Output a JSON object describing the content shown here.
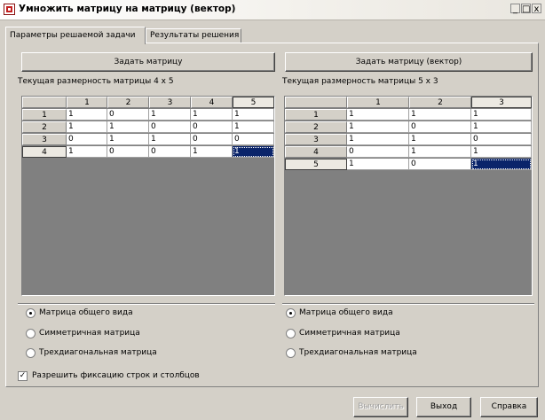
{
  "window": {
    "title": "Умножить матрицу на матрицу (вектор)",
    "minimize_glyph": "_",
    "maximize_glyph": "□",
    "close_glyph": "x"
  },
  "tabs": [
    {
      "label": "Параметры решаемой задачи",
      "active": true
    },
    {
      "label": "Результаты решения",
      "active": false
    }
  ],
  "left": {
    "button_label": "Задать матрицу",
    "dims_label": "Текущая размерность матрицы 4 x 5",
    "col_headers": [
      "1",
      "2",
      "3",
      "4",
      "5"
    ],
    "row_headers": [
      "1",
      "2",
      "3",
      "4"
    ],
    "rows": [
      [
        "1",
        "0",
        "1",
        "1",
        "1"
      ],
      [
        "1",
        "1",
        "0",
        "0",
        "1"
      ],
      [
        "0",
        "1",
        "1",
        "0",
        "0"
      ],
      [
        "1",
        "0",
        "0",
        "1",
        "1"
      ]
    ],
    "radios": [
      {
        "label": "Матрица общего вида",
        "checked": true
      },
      {
        "label": "Симметричная матрица",
        "checked": false
      },
      {
        "label": "Трехдиагональная матрица",
        "checked": false
      }
    ]
  },
  "right": {
    "button_label": "Задать матрицу (вектор)",
    "dims_label": "Текущая размерность матрицы 5 x 3",
    "col_headers": [
      "1",
      "2",
      "3"
    ],
    "row_headers": [
      "1",
      "2",
      "3",
      "4",
      "5"
    ],
    "rows": [
      [
        "1",
        "1",
        "1"
      ],
      [
        "1",
        "0",
        "1"
      ],
      [
        "1",
        "1",
        "0"
      ],
      [
        "0",
        "1",
        "1"
      ],
      [
        "1",
        "0",
        "1"
      ]
    ],
    "radios": [
      {
        "label": "Матрица общего вида",
        "checked": true
      },
      {
        "label": "Симметричная матрица",
        "checked": false
      },
      {
        "label": "Трехдиагональная матрица",
        "checked": false
      }
    ]
  },
  "fix_checkbox": {
    "label": "Разрешить фиксацию строк и столбцов",
    "checked": true,
    "check_glyph": "✓"
  },
  "buttons": {
    "compute": "Вычислить",
    "exit": "Выход",
    "help": "Справка"
  },
  "colors": {
    "selection": "#0a246a",
    "grid_bg": "#808080",
    "face": "#d4d0c8"
  }
}
